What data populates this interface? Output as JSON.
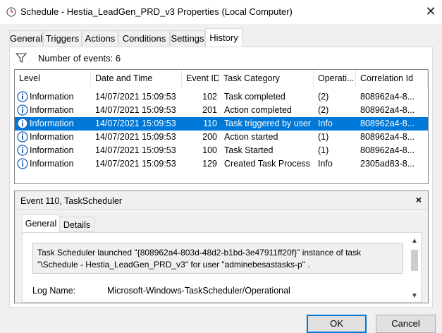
{
  "window": {
    "title": "Schedule - Hestia_LeadGen_PRD_v3 Properties (Local Computer)",
    "close_glyph": "✕"
  },
  "tabs": [
    {
      "label": "General"
    },
    {
      "label": "Triggers"
    },
    {
      "label": "Actions"
    },
    {
      "label": "Conditions"
    },
    {
      "label": "Settings"
    },
    {
      "label": "History"
    }
  ],
  "active_tab": "History",
  "filter": {
    "text": "Number of events: 6"
  },
  "table": {
    "columns": [
      "Level",
      "Date and Time",
      "Event ID",
      "Task Category",
      "Operati...",
      "Correlation Id"
    ],
    "rows": [
      {
        "level": "Information",
        "datetime": "14/07/2021 15:09:53",
        "event_id": "102",
        "category": "Task completed",
        "opcode": "(2)",
        "correlation": "808962a4-8..."
      },
      {
        "level": "Information",
        "datetime": "14/07/2021 15:09:53",
        "event_id": "201",
        "category": "Action completed",
        "opcode": "(2)",
        "correlation": "808962a4-8..."
      },
      {
        "level": "Information",
        "datetime": "14/07/2021 15:09:53",
        "event_id": "110",
        "category": "Task triggered by user",
        "opcode": "Info",
        "correlation": "808962a4-8..."
      },
      {
        "level": "Information",
        "datetime": "14/07/2021 15:09:53",
        "event_id": "200",
        "category": "Action started",
        "opcode": "(1)",
        "correlation": "808962a4-8..."
      },
      {
        "level": "Information",
        "datetime": "14/07/2021 15:09:53",
        "event_id": "100",
        "category": "Task Started",
        "opcode": "(1)",
        "correlation": "808962a4-8..."
      },
      {
        "level": "Information",
        "datetime": "14/07/2021 15:09:53",
        "event_id": "129",
        "category": "Created Task Process",
        "opcode": "Info",
        "correlation": "2305ad83-8..."
      }
    ],
    "selected_index": 2
  },
  "detail": {
    "title": "Event 110, TaskScheduler",
    "close_glyph": "×",
    "tabs": [
      "General",
      "Details"
    ],
    "active_tab": "General",
    "message": "Task Scheduler launched \"{808962a4-803d-48d2-b1bd-3e47911ff20f}\"  instance of task \"\\Schedule - Hestia_LeadGen_PRD_v3\"  for user \"adminebesastasks-p\" .",
    "log_name_label": "Log Name:",
    "log_name_value": "Microsoft-Windows-TaskScheduler/Operational"
  },
  "buttons": {
    "ok": "OK",
    "cancel": "Cancel"
  },
  "colors": {
    "selection": "#0078d7",
    "info_icon": "#1a5fb4"
  }
}
